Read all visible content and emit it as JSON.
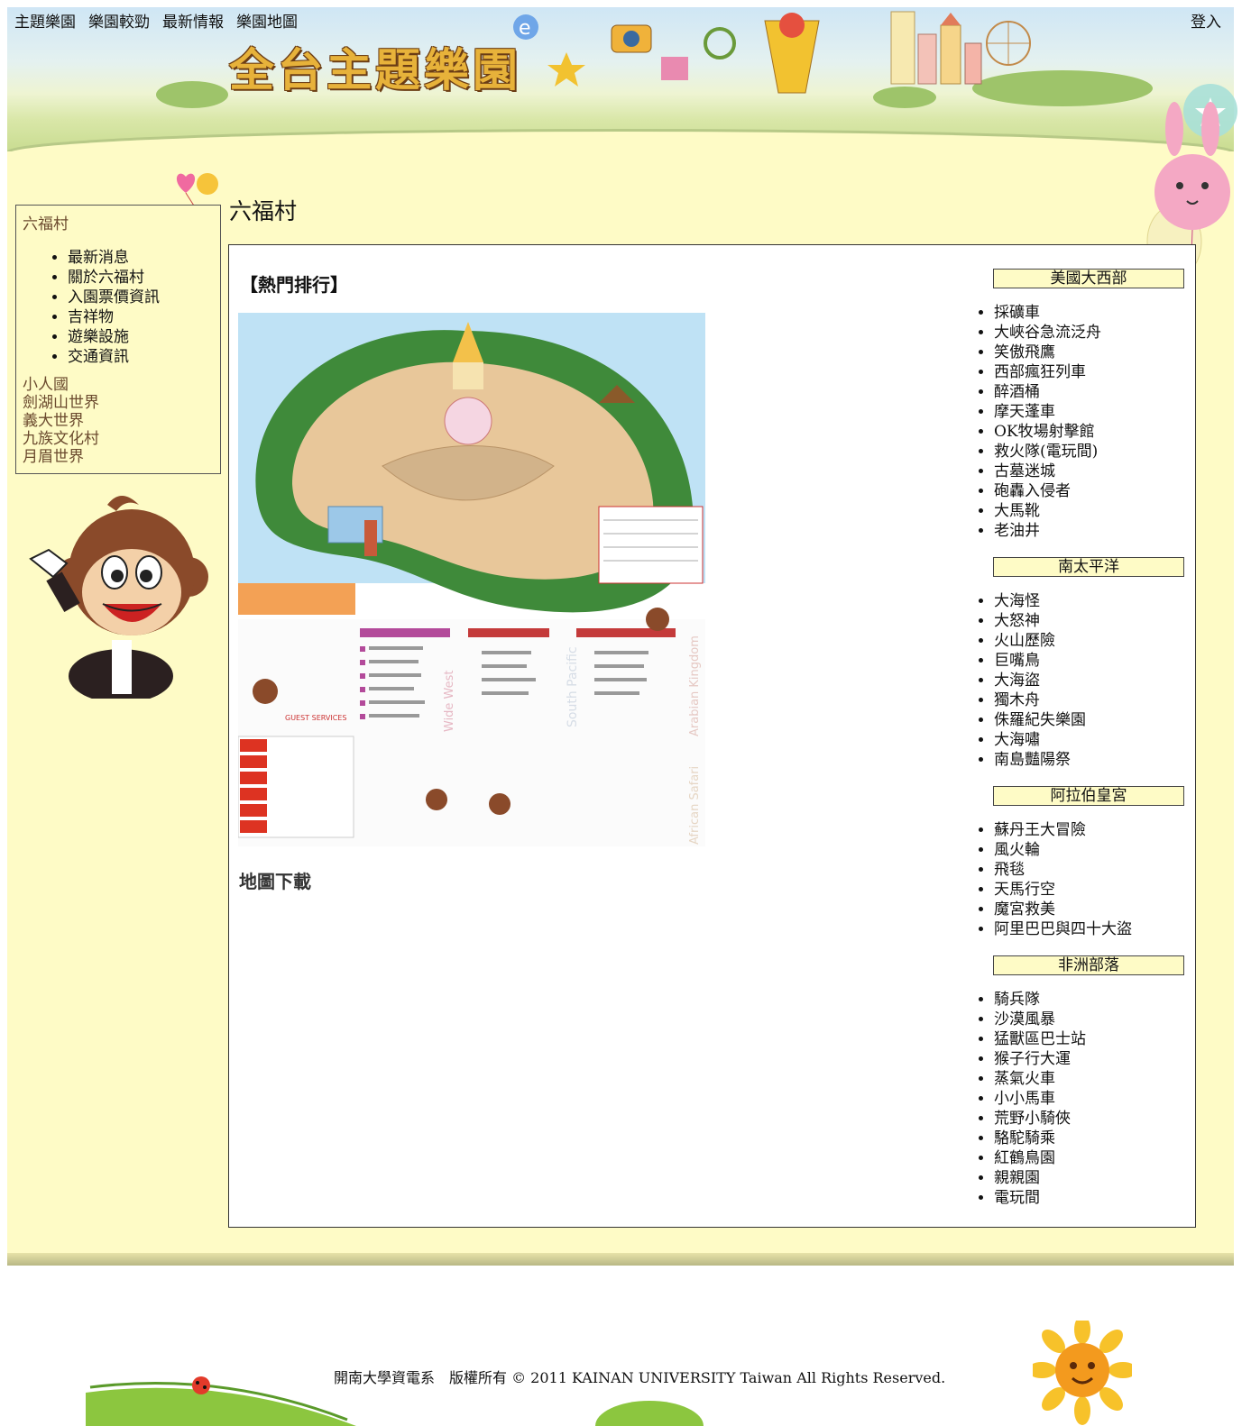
{
  "topnav": {
    "items": [
      "主題樂園",
      "樂園較勁",
      "最新情報",
      "樂園地圖"
    ],
    "login": "登入"
  },
  "site_title": "全台主題樂園",
  "leftnav": {
    "current": "六福村",
    "sub_items": [
      "最新消息",
      "關於六福村",
      "入園票價資訊",
      "吉祥物",
      "遊樂設施",
      "交通資訊"
    ],
    "parks": [
      "小人國",
      "劍湖山世界",
      "義大世界",
      "九族文化村",
      "月眉世界"
    ]
  },
  "page_title": "六福村",
  "content": {
    "hot_heading": "【熱門排行】",
    "map_download": "地圖下載",
    "map_labels": [
      "Wide West",
      "South Pacific",
      "Arabian Kingdom",
      "African Safari",
      "GUEST SERVICES"
    ]
  },
  "zones": [
    {
      "name": "美國大西部",
      "rides": [
        "採礦車",
        "大峽谷急流泛舟",
        "笑傲飛鷹",
        "西部瘋狂列車",
        "醉酒桶",
        "摩天蓬車",
        "OK牧場射擊館",
        "救火隊(電玩間)",
        "古墓迷城",
        "砲轟入侵者",
        "大馬靴",
        "老油井"
      ]
    },
    {
      "name": "南太平洋",
      "rides": [
        "大海怪",
        "大怒神",
        "火山歷險",
        "巨嘴鳥",
        "大海盜",
        "獨木舟",
        "侏羅紀失樂園",
        "大海嘯",
        "南島豔陽祭"
      ]
    },
    {
      "name": "阿拉伯皇宮",
      "rides": [
        "蘇丹王大冒險",
        "風火輪",
        "飛毯",
        "天馬行空",
        "魔宮救美",
        "阿里巴巴與四十大盜"
      ]
    },
    {
      "name": "非洲部落",
      "rides": [
        "騎兵隊",
        "沙漠風暴",
        "猛獸區巴士站",
        "猴子行大運",
        "蒸氣火車",
        "小小馬車",
        "荒野小騎俠",
        "駱駝騎乘",
        "紅鶴鳥園",
        "親親園",
        "電玩間"
      ]
    }
  ],
  "footer": "開南大學資電系　版權所有 © 2011 KAINAN UNIVERSITY Taiwan All Rights Reserved.",
  "colors": {
    "band": "#fefbc6",
    "link_brown": "#6b4a2e",
    "title_gold": "#e7b23a"
  }
}
